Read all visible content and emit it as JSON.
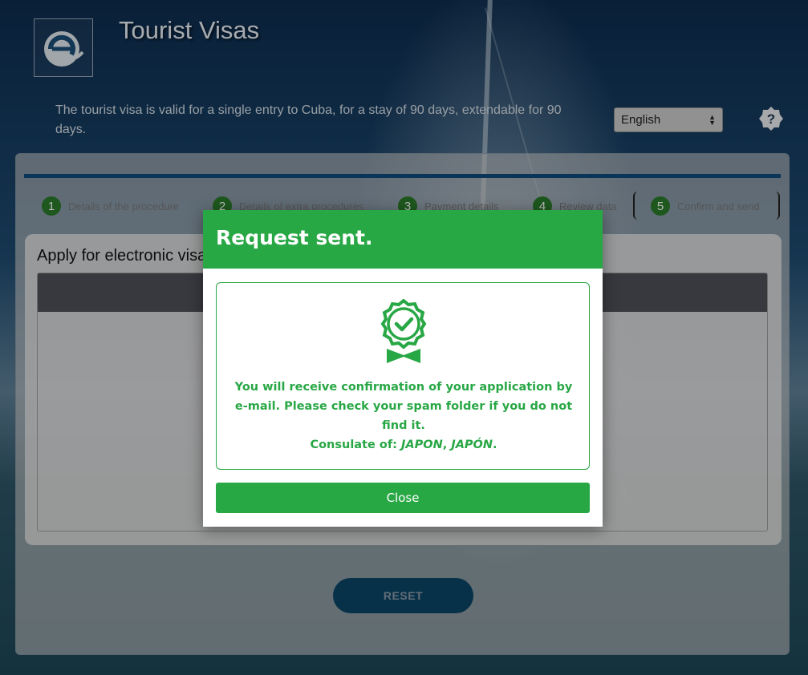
{
  "header": {
    "title": "Tourist Visas",
    "description": "The tourist visa is valid for a single entry to Cuba, for a stay of 90 days, extendable for 90 days.",
    "language": "English"
  },
  "steps": [
    {
      "num": "1",
      "label": "Details of the procedure"
    },
    {
      "num": "2",
      "label": "Details of extra procedures"
    },
    {
      "num": "3",
      "label": "Payment details"
    },
    {
      "num": "4",
      "label": "Review data"
    },
    {
      "num": "5",
      "label": "Confirm and send"
    }
  ],
  "main": {
    "section_title": "Apply for electronic visa",
    "reset_label": "RESET"
  },
  "modal": {
    "title": "Request sent.",
    "message": "You will receive confirmation of your application by e-mail. Please check your spam folder if you do not find it.",
    "consulate_label": "Consulate of:",
    "consulate_value": "JAPON",
    "consulate_value2": "JAPÓN",
    "close_label": "Close"
  },
  "colors": {
    "success_green": "#28a745",
    "progress_blue": "#0e4a7c"
  }
}
